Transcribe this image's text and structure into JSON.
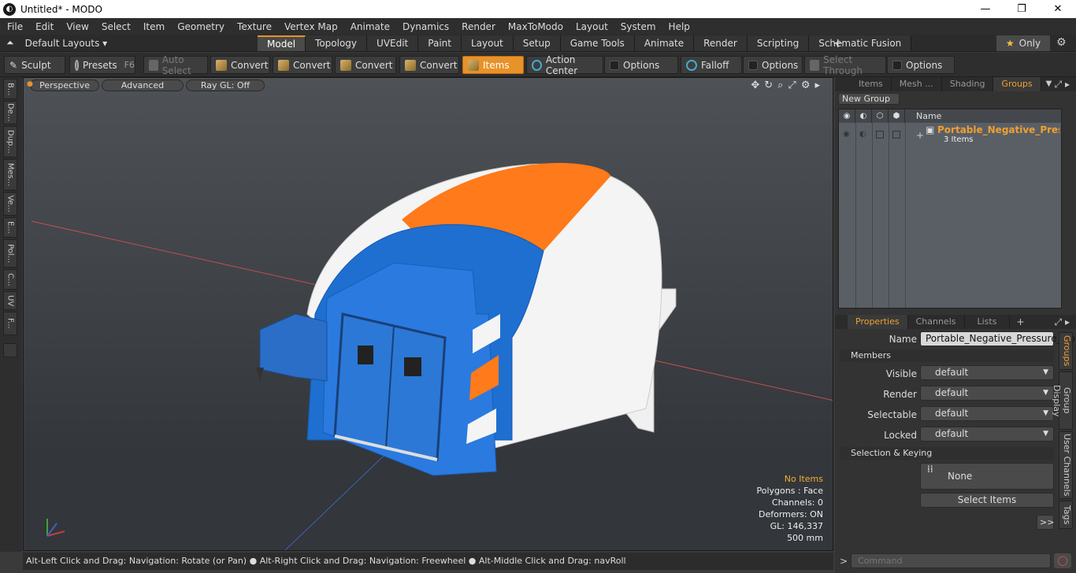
{
  "window": {
    "title": "Untitled* - MODO",
    "minimize": "—",
    "maximize": "❐",
    "close": "✕"
  },
  "menu": [
    "File",
    "Edit",
    "View",
    "Select",
    "Item",
    "Geometry",
    "Texture",
    "Vertex Map",
    "Animate",
    "Dynamics",
    "Render",
    "MaxToModo",
    "Layout",
    "System",
    "Help"
  ],
  "layout_selector": "Default Layouts ▾",
  "layout_tabs": [
    {
      "label": "Model",
      "active": true
    },
    {
      "label": "Topology"
    },
    {
      "label": "UVEdit"
    },
    {
      "label": "Paint"
    },
    {
      "label": "Layout"
    },
    {
      "label": "Setup"
    },
    {
      "label": "Game Tools"
    },
    {
      "label": "Animate"
    },
    {
      "label": "Render"
    },
    {
      "label": "Scripting"
    },
    {
      "label": "Schematic Fusion"
    }
  ],
  "only_label": "Only",
  "toolbar": {
    "sculpt": "Sculpt",
    "presets": "Presets",
    "presets_key": "F6",
    "auto_select": "Auto Select",
    "convert": "Convert",
    "items": "Items",
    "action_center": "Action Center",
    "options": "Options",
    "falloff": "Falloff",
    "select_through": "Select Through"
  },
  "left_tabs": [
    "B...",
    "De...",
    "Dup...",
    "Mes...",
    "Ve...",
    "E...",
    "Pol...",
    "C...",
    "UV",
    "F..."
  ],
  "viewport": {
    "perspective": "Perspective",
    "advanced": "Advanced",
    "raygl": "Ray GL: Off",
    "stats": {
      "no_items": "No Items",
      "polygons": "Polygons : Face",
      "channels": "Channels: 0",
      "deformers": "Deformers: ON",
      "gl": "GL: 146,337",
      "scale": "500 mm"
    }
  },
  "statusbar": "Alt-Left Click and Drag: Navigation: Rotate (or Pan) ● Alt-Right Click and Drag: Navigation: Freewheel ● Alt-Middle Click and Drag: navRoll",
  "top_panel": {
    "tabs": [
      {
        "label": "Items"
      },
      {
        "label": "Mesh ..."
      },
      {
        "label": "Shading"
      },
      {
        "label": "Groups",
        "active": true
      }
    ],
    "new_group": "New Group",
    "name_col": "Name",
    "group_name": "Portable_Negative_Press...",
    "group_count": "3 Items"
  },
  "bottom_panel": {
    "tabs": [
      {
        "label": "Properties",
        "active": true
      },
      {
        "label": "Channels"
      },
      {
        "label": "Lists"
      }
    ],
    "name_label": "Name",
    "name_value": "Portable_Negative_Pressure_Iso",
    "members": "Members",
    "props": [
      {
        "label": "Visible",
        "value": "default"
      },
      {
        "label": "Render",
        "value": "default"
      },
      {
        "label": "Selectable",
        "value": "default"
      },
      {
        "label": "Locked",
        "value": "default"
      }
    ],
    "selection_keying": "Selection & Keying",
    "none": "None",
    "select_items": "Select Items",
    "more": ">>",
    "side_tabs": [
      {
        "label": "Groups",
        "active": true
      },
      {
        "label": "Group Display"
      },
      {
        "label": "User Channels"
      },
      {
        "label": "Tags"
      }
    ]
  },
  "command_placeholder": "Command"
}
